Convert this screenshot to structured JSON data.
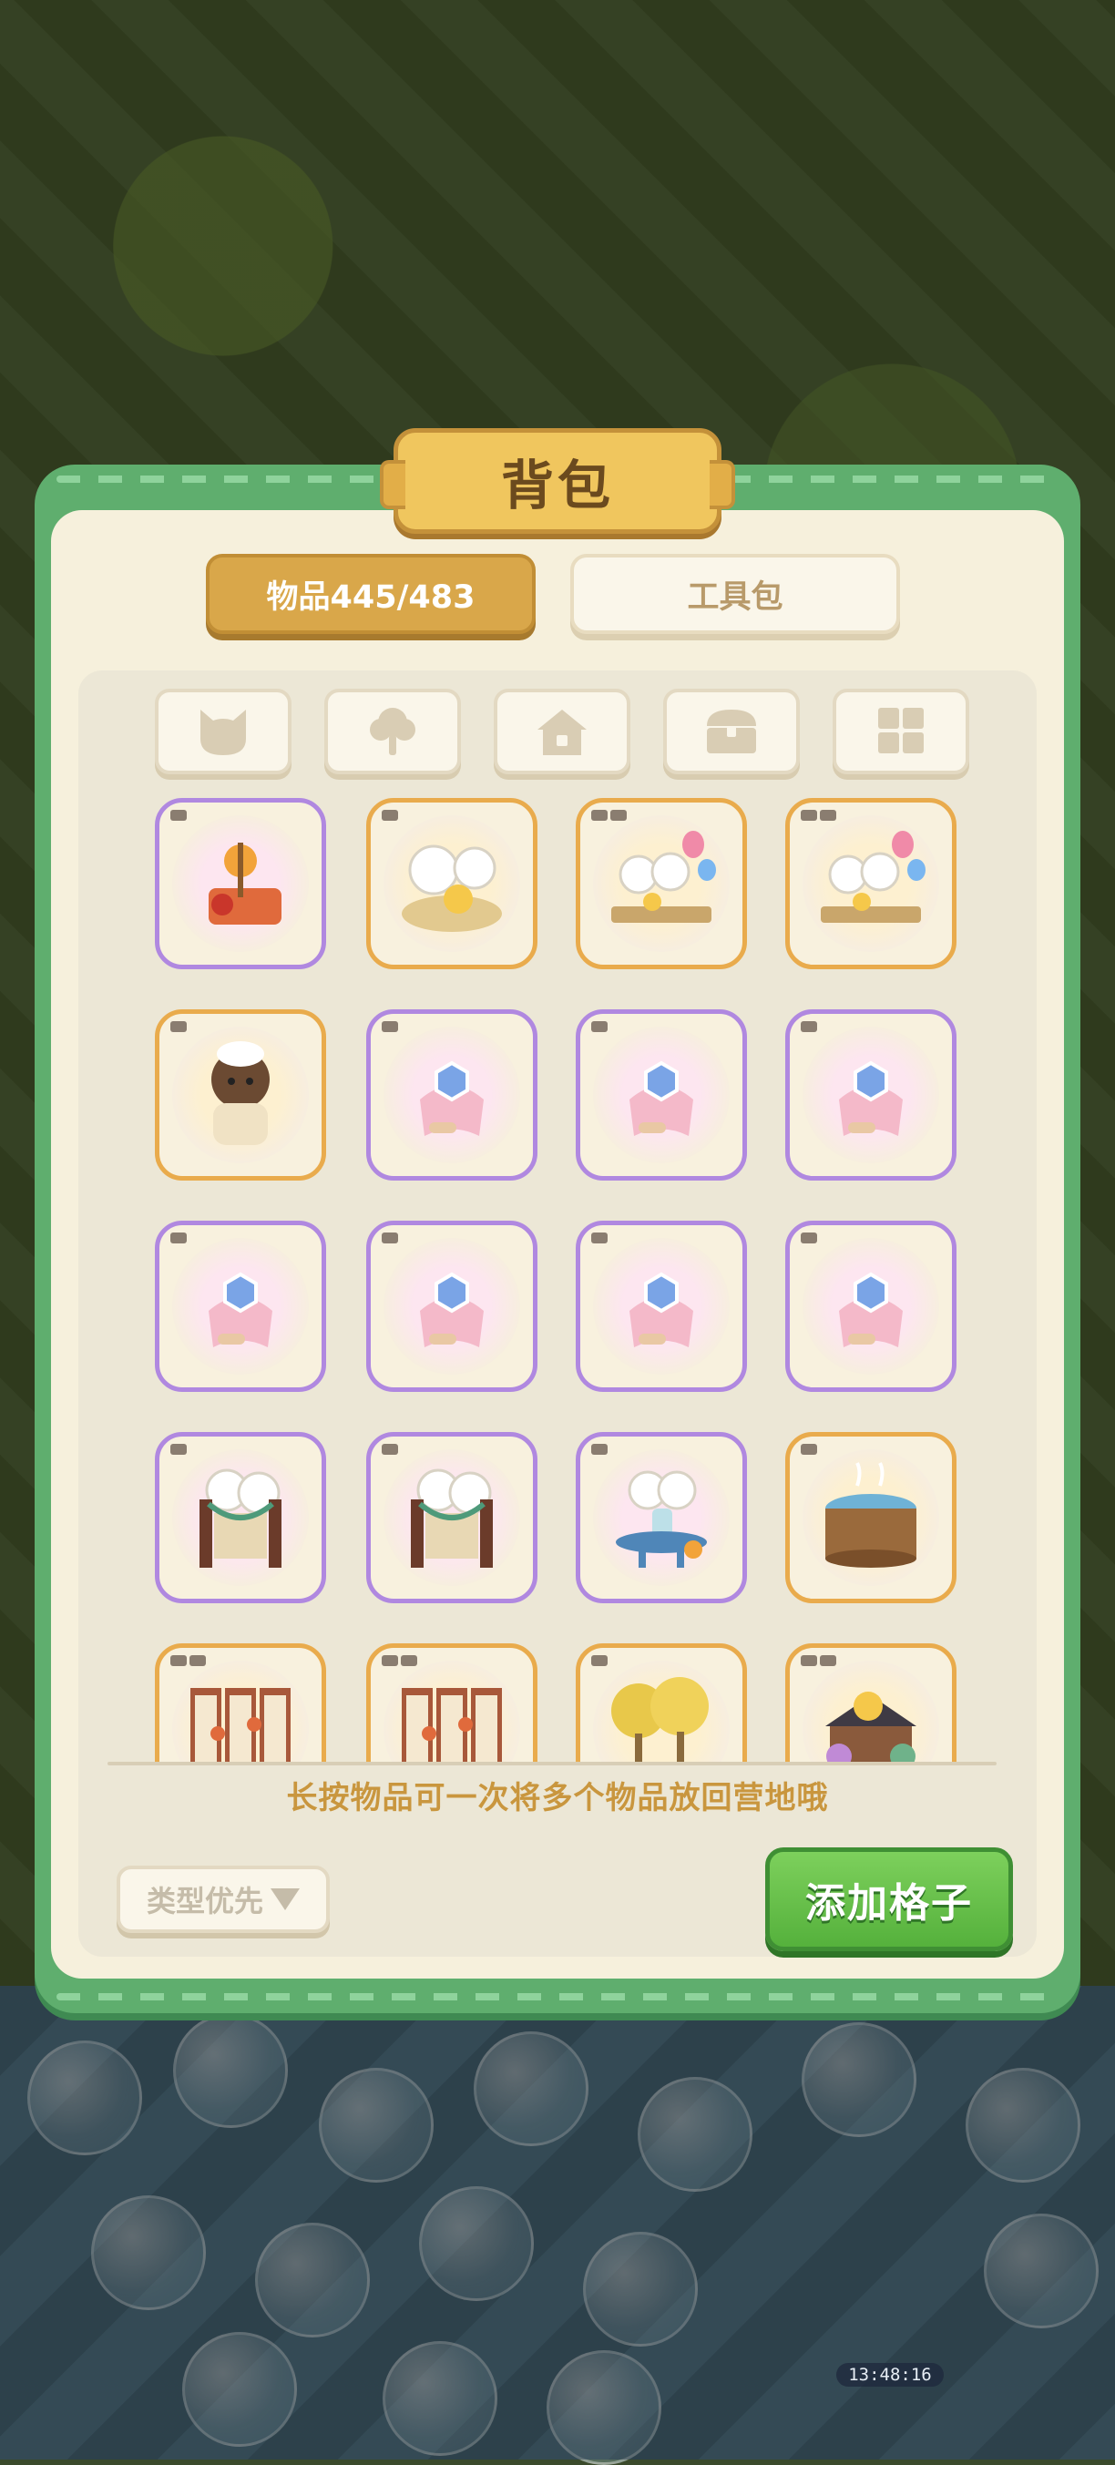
{
  "panel": {
    "title": "背包",
    "tabs": [
      {
        "label": "物品445/483",
        "active": true
      },
      {
        "label": "工具包",
        "active": false
      }
    ],
    "filters": [
      {
        "icon": "cat-icon",
        "active": true
      },
      {
        "icon": "tree-icon",
        "active": false
      },
      {
        "icon": "house-icon",
        "active": false
      },
      {
        "icon": "chest-icon",
        "active": false
      },
      {
        "icon": "grid-icon",
        "active": false
      }
    ],
    "items": [
      {
        "icon": "lantern-decoration-icon",
        "rarity": "purple",
        "tag_count": 1
      },
      {
        "icon": "dandelion-duck-icon",
        "rarity": "orange",
        "tag_count": 1
      },
      {
        "icon": "flower-fence-balloon-icon",
        "rarity": "orange",
        "tag_count": 2
      },
      {
        "icon": "flower-fence-balloon-icon",
        "rarity": "orange",
        "tag_count": 2
      },
      {
        "icon": "bear-chef-icon",
        "rarity": "orange",
        "tag_count": 1
      },
      {
        "icon": "scroll-badge-icon",
        "rarity": "purple",
        "tag_count": 1
      },
      {
        "icon": "scroll-badge-icon",
        "rarity": "purple",
        "tag_count": 1
      },
      {
        "icon": "scroll-badge-icon",
        "rarity": "purple",
        "tag_count": 1
      },
      {
        "icon": "scroll-badge-icon",
        "rarity": "purple",
        "tag_count": 1
      },
      {
        "icon": "scroll-badge-icon",
        "rarity": "purple",
        "tag_count": 1
      },
      {
        "icon": "scroll-badge-icon",
        "rarity": "purple",
        "tag_count": 1
      },
      {
        "icon": "scroll-badge-icon",
        "rarity": "purple",
        "tag_count": 1
      },
      {
        "icon": "flower-arch-icon",
        "rarity": "purple",
        "tag_count": 1
      },
      {
        "icon": "flower-arch-icon",
        "rarity": "purple",
        "tag_count": 1
      },
      {
        "icon": "flower-vase-table-icon",
        "rarity": "purple",
        "tag_count": 1
      },
      {
        "icon": "wooden-hot-tub-icon",
        "rarity": "orange",
        "tag_count": 1
      },
      {
        "icon": "folding-screen-icon",
        "rarity": "orange",
        "tag_count": 2
      },
      {
        "icon": "folding-screen-icon",
        "rarity": "orange",
        "tag_count": 2
      },
      {
        "icon": "ginkgo-trees-icon",
        "rarity": "orange",
        "tag_count": 1
      },
      {
        "icon": "garden-house-duck-icon",
        "rarity": "orange",
        "tag_count": 2
      }
    ],
    "hint": "长按物品可一次将多个物品放回营地哦",
    "sort_label": "类型优先",
    "add_slot_label": "添加格子"
  },
  "hud": {
    "timer": "13:48:16"
  }
}
